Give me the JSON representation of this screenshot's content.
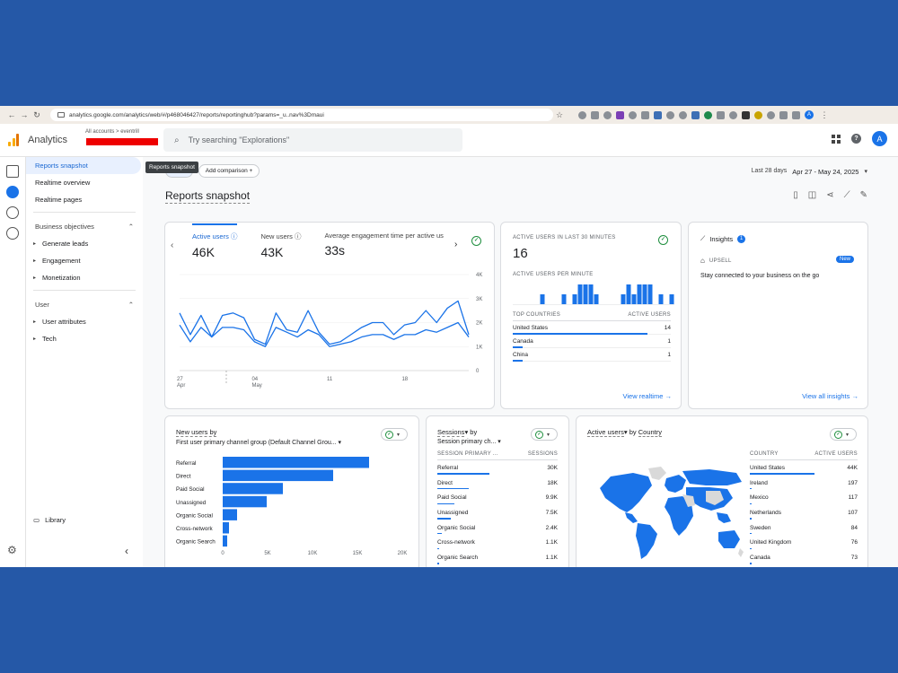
{
  "browser": {
    "url": "analytics.google.com/analytics/web/#/p468046427/reports/reportinghub?params=_u..nav%3Dmaui"
  },
  "header": {
    "app_name": "Analytics",
    "breadcrumb": "All accounts  >  eventrill",
    "search_placeholder": "Try searching \"Explorations\"",
    "avatar_letter": "A"
  },
  "sidebar": {
    "items": [
      "Reports snapshot",
      "Realtime overview",
      "Realtime pages"
    ],
    "section_business": "Business objectives",
    "business_items": [
      "Generate leads",
      "Engagement",
      "Monetization"
    ],
    "section_user": "User",
    "user_items": [
      "User attributes",
      "Tech"
    ],
    "library": "Library",
    "tooltip": "Reports snapshot"
  },
  "toolbar": {
    "add_comparison": "Add comparison",
    "date_label": "Last 28 days",
    "date_range": "Apr 27 - May 24, 2025",
    "page_title": "Reports snapshot"
  },
  "overview": {
    "metrics": [
      {
        "label": "Active users",
        "value": "46K"
      },
      {
        "label": "New users",
        "value": "43K"
      },
      {
        "label": "Average engagement time per active us",
        "value": "33s"
      }
    ],
    "y_ticks": [
      "4K",
      "3K",
      "2K",
      "1K",
      "0"
    ],
    "x_ticks": [
      {
        "d": "27",
        "m": "Apr"
      },
      {
        "d": "04",
        "m": "May"
      },
      {
        "d": "11",
        "m": ""
      },
      {
        "d": "18",
        "m": ""
      }
    ]
  },
  "chart_data": [
    {
      "type": "line",
      "ylim": [
        0,
        4000
      ],
      "series": [
        {
          "name": "Active users",
          "values": [
            2400,
            1500,
            2300,
            1400,
            2300,
            2400,
            2200,
            1300,
            1100,
            2400,
            1700,
            1600,
            2500,
            1600,
            1100,
            1200,
            1500,
            1800,
            2000,
            2000,
            1500,
            1900,
            2000,
            2500,
            2000,
            2600,
            2900,
            1500
          ]
        },
        {
          "name": "Active users (comparison)",
          "values": [
            1900,
            1200,
            1800,
            1400,
            1800,
            1800,
            1700,
            1200,
            1000,
            1800,
            1600,
            1400,
            1700,
            1500,
            1000,
            1100,
            1200,
            1400,
            1500,
            1500,
            1300,
            1500,
            1500,
            1700,
            1600,
            1800,
            2000,
            1400
          ]
        }
      ]
    },
    {
      "type": "bar",
      "title": "Active users per minute",
      "values": [
        0,
        0,
        0,
        0,
        0,
        1,
        0,
        0,
        0,
        1,
        0,
        1,
        2,
        2,
        2,
        1,
        0,
        0,
        0,
        0,
        1,
        2,
        1,
        2,
        2,
        2,
        0,
        1,
        0,
        1
      ]
    },
    {
      "type": "bar",
      "title": "New users by First user primary channel group (Default Channel Group)",
      "categories": [
        "Referral",
        "Direct",
        "Paid Social",
        "Unassigned",
        "Organic Social",
        "Cross-network",
        "Organic Search"
      ],
      "values": [
        16300,
        12300,
        6700,
        4900,
        1600,
        700,
        500
      ],
      "x_ticks": [
        "0",
        "5K",
        "10K",
        "15K",
        "20K"
      ],
      "xlim": [
        0,
        20000
      ]
    }
  ],
  "realtime": {
    "title": "ACTIVE USERS IN LAST 30 MINUTES",
    "value": "16",
    "per_minute": "ACTIVE USERS PER MINUTE",
    "col1": "TOP COUNTRIES",
    "col2": "ACTIVE USERS",
    "countries": [
      {
        "name": "United States",
        "value": "14",
        "share": 1.0
      },
      {
        "name": "Canada",
        "value": "1",
        "share": 0.07
      },
      {
        "name": "China",
        "value": "1",
        "share": 0.07
      }
    ],
    "link": "View realtime"
  },
  "insights": {
    "title": "Insights",
    "badge": "1",
    "tag": "UPSELL",
    "new_label": "New",
    "message": "Stay connected to your business on the go",
    "link": "View all insights"
  },
  "new_users": {
    "title_line1": "New users by",
    "title_line2": "First user primary channel group (Default Channel Grou..."
  },
  "sessions": {
    "title_line1": "Sessions",
    "title_by": "by",
    "title_line2": "Session primary ch...",
    "col1": "SESSION PRIMARY ...",
    "col2": "SESSIONS",
    "rows": [
      {
        "name": "Referral",
        "value": "30K",
        "share": 1.0
      },
      {
        "name": "Direct",
        "value": "18K",
        "share": 0.6
      },
      {
        "name": "Paid Social",
        "value": "9.9K",
        "share": 0.33
      },
      {
        "name": "Unassigned",
        "value": "7.5K",
        "share": 0.25
      },
      {
        "name": "Organic Social",
        "value": "2.4K",
        "share": 0.08
      },
      {
        "name": "Cross-network",
        "value": "1.1K",
        "share": 0.04
      },
      {
        "name": "Organic Search",
        "value": "1.1K",
        "share": 0.04
      }
    ]
  },
  "country": {
    "title_a": "Active users",
    "title_by": "by",
    "title_b": "Country",
    "col1": "COUNTRY",
    "col2": "ACTIVE USERS",
    "rows": [
      {
        "name": "United States",
        "value": "44K",
        "share": 1.0
      },
      {
        "name": "Ireland",
        "value": "197",
        "share": 0.01
      },
      {
        "name": "Mexico",
        "value": "117",
        "share": 0.01
      },
      {
        "name": "Netherlands",
        "value": "107",
        "share": 0.01
      },
      {
        "name": "Sweden",
        "value": "84",
        "share": 0.01
      },
      {
        "name": "United Kingdom",
        "value": "76",
        "share": 0.01
      },
      {
        "name": "Canada",
        "value": "73",
        "share": 0.01
      }
    ]
  },
  "colors": {
    "accent": "#1a73e8",
    "map_active": "#1a73e8",
    "map_inactive": "#d9d9d9",
    "frame": "#2558a7"
  }
}
